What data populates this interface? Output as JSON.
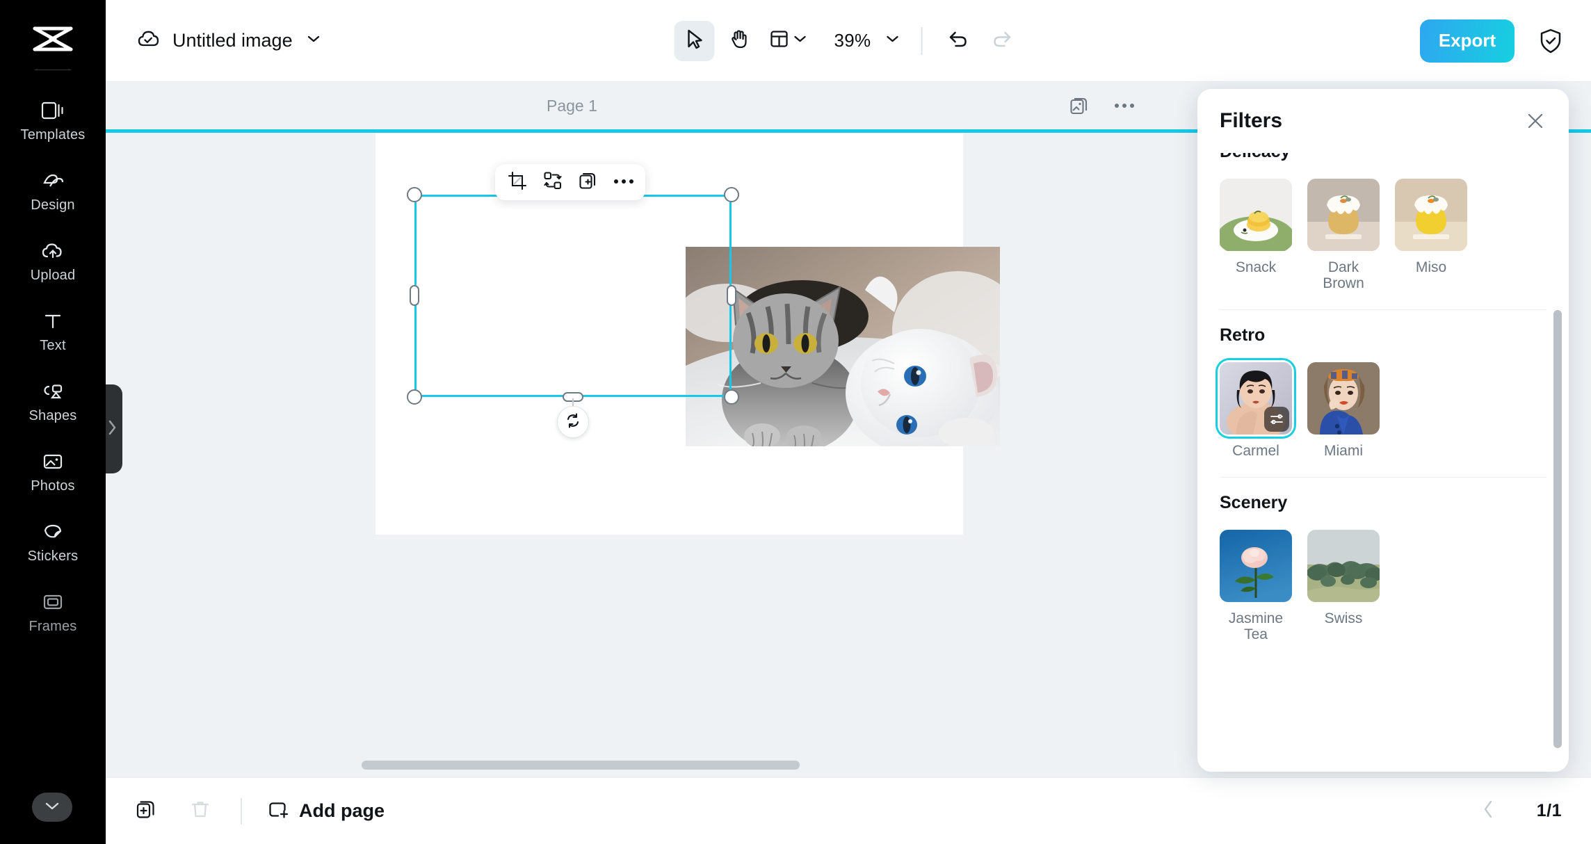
{
  "app": {
    "logo_icon": "capcut-logo-icon",
    "accent_color": "#17c8e8",
    "export_gradient_from": "#2ea7f0",
    "export_gradient_to": "#17cfe0"
  },
  "sidebar": {
    "items": [
      {
        "label": "Templates",
        "icon": "templates-icon"
      },
      {
        "label": "Design",
        "icon": "design-icon"
      },
      {
        "label": "Upload",
        "icon": "upload-cloud-icon"
      },
      {
        "label": "Text",
        "icon": "text-icon"
      },
      {
        "label": "Shapes",
        "icon": "shapes-icon"
      },
      {
        "label": "Photos",
        "icon": "photos-icon"
      },
      {
        "label": "Stickers",
        "icon": "stickers-icon"
      },
      {
        "label": "Frames",
        "icon": "frames-icon"
      }
    ],
    "more_icon": "chevron-down-icon",
    "expand_tab_icon": "chevron-right-icon"
  },
  "topbar": {
    "cloud_status_icon": "cloud-saved-icon",
    "doc_title": "Untitled image",
    "doc_menu_icon": "chevron-down-icon",
    "tools": [
      {
        "name": "select-tool",
        "icon": "cursor-arrow-icon",
        "active": true
      },
      {
        "name": "hand-tool",
        "icon": "hand-icon",
        "active": false
      }
    ],
    "layout_icon": "layout-icon",
    "layout_chevron_icon": "chevron-down-icon",
    "zoom_value": "39%",
    "zoom_chevron_icon": "chevron-down-icon",
    "undo_icon": "undo-icon",
    "redo_icon": "redo-icon",
    "export_label": "Export",
    "shield_icon": "shield-check-icon"
  },
  "canvas": {
    "page_label": "Page 1",
    "header_icons": [
      {
        "name": "copy-page-icon",
        "icon": "copy-image-icon"
      },
      {
        "name": "page-more-icon",
        "icon": "more-dots-icon"
      }
    ],
    "float_toolbar": [
      {
        "name": "crop-button",
        "icon": "crop-icon"
      },
      {
        "name": "replace-button",
        "icon": "swap-icon"
      },
      {
        "name": "duplicate-button",
        "icon": "duplicate-layer-icon"
      },
      {
        "name": "more-button",
        "icon": "more-dots-icon"
      }
    ],
    "rotate_icon": "rotate-icon",
    "selected_object": "cats-photo",
    "horizontal_scrollbar": "canvas-hscrollbar"
  },
  "bottombar": {
    "duplicate_icon": "duplicate-page-icon",
    "delete_icon": "trash-icon",
    "add_page_label": "Add page",
    "add_page_icon": "add-page-icon",
    "prev_page_icon": "chevron-left-icon",
    "page_count": "1/1"
  },
  "filters_panel": {
    "title": "Filters",
    "close_icon": "close-icon",
    "selected_filter": "Carmel",
    "sections": [
      {
        "title": "Delicacy",
        "clipped": true,
        "items": [
          {
            "label": "Snack",
            "thumb": "snack-thumb",
            "selected": false
          },
          {
            "label": "Dark Brown",
            "thumb": "dark-brown-thumb",
            "selected": false
          },
          {
            "label": "Miso",
            "thumb": "miso-thumb",
            "selected": false
          }
        ]
      },
      {
        "title": "Retro",
        "clipped": false,
        "items": [
          {
            "label": "Carmel",
            "thumb": "carmel-thumb",
            "selected": true,
            "badge_icon": "adjust-sliders-icon"
          },
          {
            "label": "Miami",
            "thumb": "miami-thumb",
            "selected": false
          }
        ]
      },
      {
        "title": "Scenery",
        "clipped": false,
        "items": [
          {
            "label": "Jasmine Tea",
            "thumb": "jasmine-tea-thumb",
            "selected": false
          },
          {
            "label": "Swiss",
            "thumb": "swiss-thumb",
            "selected": false
          }
        ]
      }
    ]
  }
}
